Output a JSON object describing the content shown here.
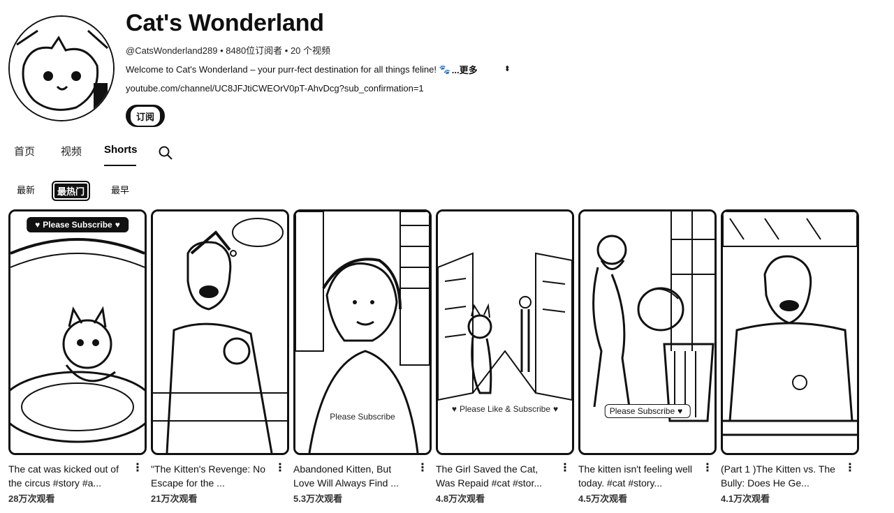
{
  "channel": {
    "name": "Cat's Wonderland",
    "meta": "@CatsWonderland289 • 8480位订阅者 • 20 个视频",
    "description": "Welcome to Cat's Wonderland – your purr-fect destination for all things feline! 🐾",
    "more_label": "...更多",
    "link": "youtube.com/channel/UC8JFJtiCWEOrV0pT-AhvDcg?sub_confirmation=1",
    "subscribe_label": "订阅"
  },
  "tabs": [
    {
      "label": "首页"
    },
    {
      "label": "视频"
    },
    {
      "label": "Shorts",
      "active": true
    }
  ],
  "chips": [
    {
      "label": "最新"
    },
    {
      "label": "最热门",
      "active": true
    },
    {
      "label": "最早"
    }
  ],
  "shorts": [
    {
      "title": "The cat was kicked out of the circus #story #a...",
      "views": "28万次观看",
      "badge": "Please Subscribe",
      "badge_style": "dark"
    },
    {
      "title": "\"The Kitten's Revenge: No Escape for the ...",
      "views": "21万次观看",
      "badge": "",
      "badge_style": ""
    },
    {
      "title": "Abandoned Kitten, But Love Will Always Find ...",
      "views": "5.3万次观看",
      "badge": "Please Subscribe",
      "badge_style": "outline"
    },
    {
      "title": "The Girl Saved the Cat, Was Repaid #cat #stor...",
      "views": "4.8万次观看",
      "badge": "Please Like & Subscribe",
      "badge_style": "outline"
    },
    {
      "title": "The kitten isn't feeling well today. #cat #story...",
      "views": "4.5万次观看",
      "badge": "Please Subscribe",
      "badge_style": "light"
    },
    {
      "title": "(Part 1 )The Kitten vs. The Bully: Does He Ge...",
      "views": "4.1万次观看",
      "badge": "",
      "badge_style": ""
    }
  ],
  "icons": {
    "search": "search-icon",
    "more": "more-vert-icon",
    "heart": "heart-icon"
  },
  "colors": {
    "text": "#0f0f0f",
    "accent": "#111111",
    "background": "#ffffff"
  }
}
